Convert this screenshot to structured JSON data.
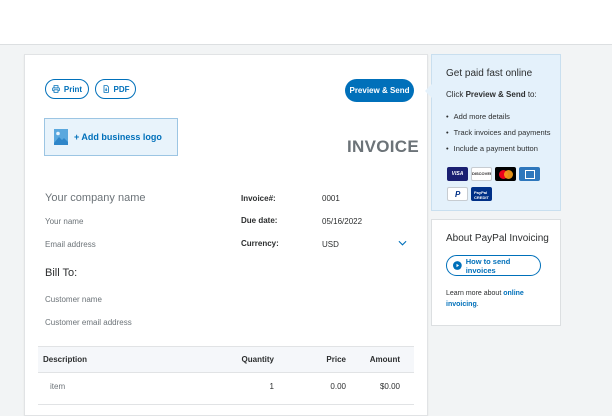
{
  "invoice": {
    "print_label": "Print",
    "pdf_label": "PDF",
    "preview_send_label": "Preview & Send",
    "add_logo_label": "+ Add business logo",
    "title": "INVOICE",
    "company_name_placeholder": "Your company name",
    "your_name_placeholder": "Your name",
    "email_placeholder": "Email address",
    "meta": {
      "invoice_no_label": "Invoice#:",
      "invoice_no_value": "0001",
      "due_date_label": "Due date:",
      "due_date_value": "05/16/2022",
      "currency_label": "Currency:",
      "currency_value": "USD"
    },
    "bill_to_label": "Bill To:",
    "customer_name_placeholder": "Customer name",
    "customer_email_placeholder": "Customer email address",
    "items_table": {
      "headers": [
        "Description",
        "Quantity",
        "Price",
        "Amount"
      ],
      "rows": [
        {
          "description": "item",
          "quantity": "1",
          "price": "0.00",
          "amount": "$0.00"
        }
      ]
    }
  },
  "promo": {
    "title": "Get paid fast online",
    "subtitle_prefix": "Click ",
    "subtitle_bold": "Preview & Send",
    "subtitle_suffix": " to:",
    "bullets": [
      "Add more details",
      "Track invoices and payments",
      "Include a payment button"
    ],
    "card_logos": [
      "visa",
      "discover",
      "mastercard",
      "amex",
      "paypal",
      "paypal-credit"
    ],
    "visa_text": "VISA",
    "discover_text": "DISCOVER",
    "paypal_text": "P",
    "paypal_credit_text": "PayPal CREDIT"
  },
  "about": {
    "title": "About PayPal Invoicing",
    "how_button_label": "How to send invoices",
    "learn_prefix": "Learn more about ",
    "learn_link": "online invoicing",
    "learn_suffix": "."
  },
  "colors": {
    "accent": "#0070ba",
    "page_bg": "#f2f4f5",
    "promo_bg": "#e4f1fb",
    "muted_text": "#6c7378"
  }
}
